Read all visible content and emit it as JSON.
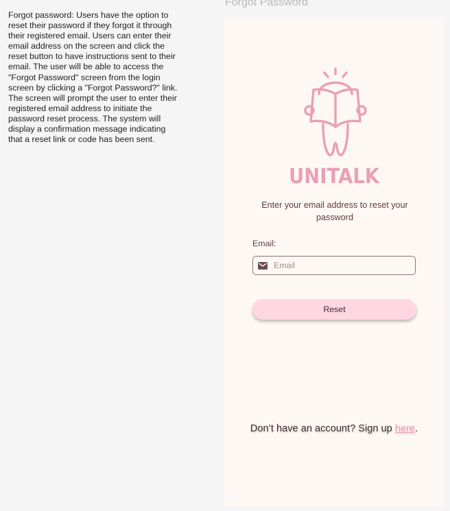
{
  "description": {
    "text": "Forgot password: Users have the option to reset their password if they forgot it through their registered email. Users can enter their email address on the screen and click the reset button to have instructions sent to their email. The user will be able to access the \"Forgot Password\" screen from the login screen by clicking a \"Forgot Password?\" link. The screen will prompt the user to enter their registered email address to initiate the password reset process. The system will display a confirmation message indicating that a reset link or code has been sent."
  },
  "frame": {
    "title": "Forgot Password"
  },
  "app": {
    "wordmark": "UNITALK",
    "prompt": "Enter your email address to reset your password",
    "email_label": "Email:",
    "email_placeholder": "Email",
    "email_value": "",
    "reset_label": "Reset",
    "signup_prefix": "Don’t have an account? Sign up ",
    "signup_link": "here",
    "signup_suffix": ".",
    "icons": {
      "field_icon": "mail-icon",
      "logo": "reading-tooth-mascot-icon"
    }
  },
  "colors": {
    "page_background": "#f5f5f5",
    "screen_background": "#fef8f4",
    "brand_pink": "#e9a0b8",
    "button_background": "#ffd7e3",
    "text_dark": "#3e2a30",
    "text_muted": "#5d3a44"
  }
}
